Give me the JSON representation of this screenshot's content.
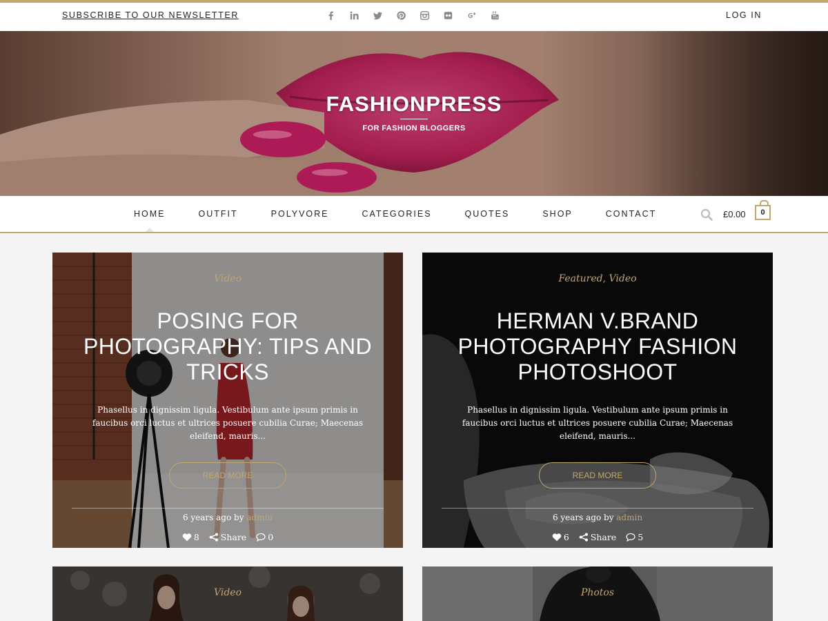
{
  "colors": {
    "accent": "#c2a66f",
    "text": "#222222",
    "background": "#f4f4f4"
  },
  "topbar": {
    "newsletter": "SUBSCRIBE TO OUR NEWSLETTER",
    "login": "LOG IN",
    "social_icons": [
      "facebook-icon",
      "linkedin-icon",
      "twitter-icon",
      "pinterest-icon",
      "instagram-icon",
      "flickr-icon",
      "google-plus-icon",
      "youtube-icon"
    ]
  },
  "hero": {
    "title": "FASHIONPRESS",
    "tagline": "FOR FASHION BLOGGERS"
  },
  "nav": {
    "items": [
      {
        "label": "HOME",
        "active": true
      },
      {
        "label": "OUTFIT"
      },
      {
        "label": "POLYVORE"
      },
      {
        "label": "CATEGORIES"
      },
      {
        "label": "QUOTES"
      },
      {
        "label": "SHOP"
      },
      {
        "label": "CONTACT"
      }
    ],
    "cart_total": "£0.00",
    "cart_count": "0"
  },
  "posts": [
    {
      "category": "Video",
      "title": "POSING FOR PHOTOGRAPHY: TIPS AND TRICKS",
      "excerpt": "Phasellus in dignissim ligula. Vestibulum ante ipsum primis in faucibus orci luctus et ultrices posuere cubilia Curae; Maecenas eleifend, mauris...",
      "read_more": "READ MORE",
      "date": "6 years ago by ",
      "author": "admin",
      "likes": "8",
      "share": "Share",
      "comments": "0"
    },
    {
      "category": "Featured, Video",
      "title": "HERMAN V.BRAND PHOTOGRAPHY FASHION PHOTOSHOOT",
      "excerpt": "Phasellus in dignissim ligula. Vestibulum ante ipsum primis in faucibus orci luctus et ultrices posuere cubilia Curae; Maecenas eleifend, mauris...",
      "read_more": "READ MORE",
      "date": "6 years ago by ",
      "author": "admin",
      "likes": "6",
      "share": "Share",
      "comments": "5"
    },
    {
      "category": "Video"
    },
    {
      "category": "Photos"
    }
  ]
}
